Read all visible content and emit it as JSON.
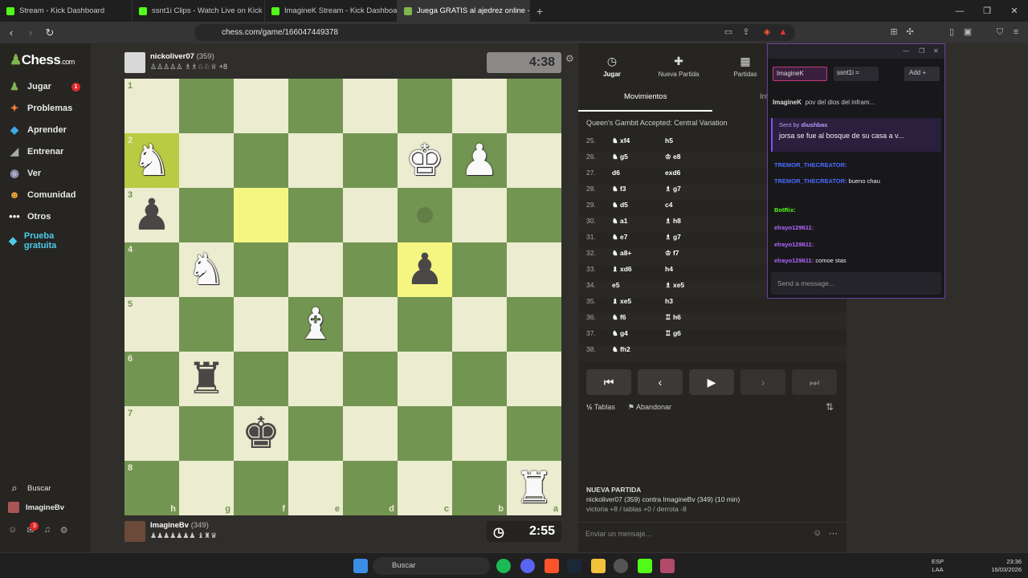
{
  "browser": {
    "tabs": [
      {
        "label": "Stream - Kick Dashboard",
        "icon": "kick-icon",
        "color": "#53fc18"
      },
      {
        "label": "ssnt1i Clips - Watch Live on Kick",
        "icon": "kick-icon",
        "color": "#53fc18"
      },
      {
        "label": "ImagineK Stream - Kick Dashboard",
        "icon": "kick-icon",
        "color": "#53fc18"
      },
      {
        "label": "Juega GRATIS al ajedrez online -",
        "icon": "chess-pawn-icon",
        "color": "#81b64c"
      }
    ],
    "url": "chess.com/game/166047449378"
  },
  "sidebar": {
    "logo": "Chess",
    "logo_suffix": ".com",
    "items": [
      {
        "label": "Jugar",
        "icon": "play-icon"
      },
      {
        "label": "Problemas",
        "icon": "puzzle-icon"
      },
      {
        "label": "Aprender",
        "icon": "learn-icon"
      },
      {
        "label": "Entrenar",
        "icon": "train-icon"
      },
      {
        "label": "Ver",
        "icon": "watch-icon"
      },
      {
        "label": "Comunidad",
        "icon": "community-icon"
      },
      {
        "label": "Otros",
        "icon": "more-icon"
      },
      {
        "label": "Prueba gratuita",
        "icon": "diamond-icon"
      }
    ],
    "jugar_badge": "1",
    "search_label": "Buscar",
    "profile_name": "ImagineBv",
    "mail_badge": "3"
  },
  "game": {
    "top_player": {
      "name": "nickoliver07",
      "rating": "(359)",
      "captured": "♙♙♙♙♙ ♗♗♘♘♕ +8"
    },
    "top_clock": "4:38",
    "bottom_player": {
      "name": "ImagineBv",
      "rating": "(349)",
      "captured": "♟♟♟♟♟♟♟ ♝♜♛"
    },
    "bottom_clock": "2:55",
    "ranks": [
      "1",
      "2",
      "3",
      "4",
      "5",
      "6",
      "7",
      "8"
    ],
    "files": [
      "h",
      "g",
      "f",
      "e",
      "d",
      "c",
      "b",
      "a"
    ],
    "pieces": [
      {
        "sq": "2-0",
        "glyph": "♞",
        "color": "w"
      },
      {
        "sq": "2-5",
        "glyph": "♚",
        "color": "w"
      },
      {
        "sq": "2-6",
        "glyph": "♟",
        "color": "w"
      },
      {
        "sq": "3-0",
        "glyph": "♟",
        "color": "b"
      },
      {
        "sq": "4-1",
        "glyph": "♞",
        "color": "w"
      },
      {
        "sq": "4-5",
        "glyph": "♟",
        "color": "b"
      },
      {
        "sq": "5-3",
        "glyph": "♝",
        "color": "w"
      },
      {
        "sq": "6-1",
        "glyph": "♜",
        "color": "b"
      },
      {
        "sq": "7-2",
        "glyph": "♚",
        "color": "b"
      },
      {
        "sq": "8-7",
        "glyph": "♜",
        "color": "w"
      }
    ]
  },
  "panel": {
    "tabs": [
      "Jugar",
      "Nueva Partida",
      "Partidas"
    ],
    "subtabs": [
      "Movimientos",
      "Inf"
    ],
    "opening": "Queen's Gambit Accepted: Central Variation",
    "moves": [
      {
        "n": "25.",
        "w": "♞ xf4",
        "b": "h5"
      },
      {
        "n": "26.",
        "w": "♞ g5",
        "b": "♔ e8"
      },
      {
        "n": "27.",
        "w": "d6",
        "b": "exd6"
      },
      {
        "n": "28.",
        "w": "♞ f3",
        "b": "♗ g7"
      },
      {
        "n": "29.",
        "w": "♞ d5",
        "b": "c4"
      },
      {
        "n": "30.",
        "w": "♞ a1",
        "b": "♗ h8"
      },
      {
        "n": "31.",
        "w": "♞ e7",
        "b": "♗ g7"
      },
      {
        "n": "32.",
        "w": "♞ a8+",
        "b": "♔ f7"
      },
      {
        "n": "33.",
        "w": "♝ xd6",
        "b": "h4"
      },
      {
        "n": "34.",
        "w": "e5",
        "b": "♗ xe5"
      },
      {
        "n": "35.",
        "w": "♝ xe5",
        "b": "h3"
      },
      {
        "n": "36.",
        "w": "♞ f6",
        "b": "♖ h6"
      },
      {
        "n": "37.",
        "w": "♞ g4",
        "b": "♖ g6"
      },
      {
        "n": "38.",
        "w": "♞ fh2",
        "b": ""
      }
    ],
    "draw_label": "Tablas",
    "resign_label": "Abandonar",
    "new_game_title": "NUEVA PARTIDA",
    "new_game_line1": "nickoliver07 (359) contra ImagineBv (349) (10 min)",
    "new_game_line2": "victoria +8 / tablas +0 / derrota -8",
    "message_placeholder": "Enviar un mensaje..."
  },
  "chat": {
    "tabs": [
      "ImagineK",
      "ssnt1i ="
    ],
    "add_label": "Add +",
    "pinned_user": "ImagineK",
    "pinned_text": "pov del dios del infram...",
    "sent_by": "Sent by",
    "sent_user": "diushbax",
    "sent_msg": "jorsa se fue al bosque de su casa a v...",
    "lines": [
      {
        "user": "TREMOR_THECREATOR:",
        "color": "#4a6cff",
        "msg": ""
      },
      {
        "user": "TREMOR_THECREATOR:",
        "color": "#4a6cff",
        "msg": "bueno chau"
      },
      {
        "user": "BotRix:",
        "color": "#53fc18",
        "msg": ""
      },
      {
        "user": "elrayo129611:",
        "color": "#b266ff",
        "msg": ""
      },
      {
        "user": "elrayo129611:",
        "color": "#b266ff",
        "msg": ""
      },
      {
        "user": "elrayo129611:",
        "color": "#b266ff",
        "msg": "comoe stas"
      }
    ],
    "input_placeholder": "Send a message..."
  },
  "taskbar": {
    "search": "Buscar",
    "lang": "ESP",
    "lang2": "LAA",
    "time": "23:36",
    "date": "16/03/2026"
  }
}
